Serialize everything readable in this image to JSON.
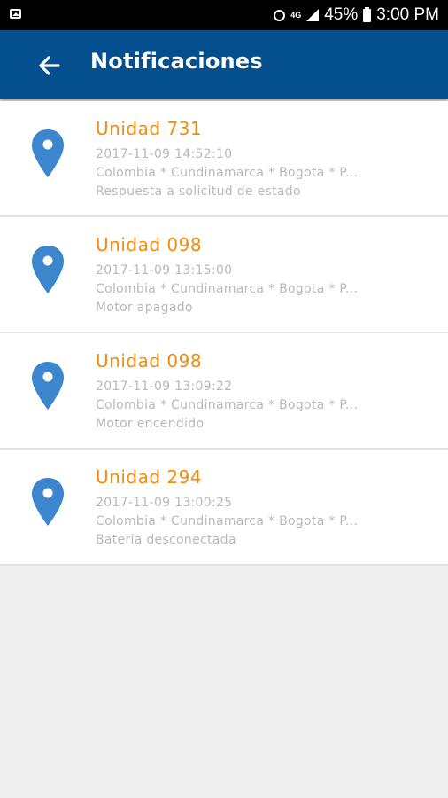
{
  "status_bar": {
    "network": "4G",
    "battery": "45%",
    "time": "3:00 PM",
    "icons": [
      "gallery-icon",
      "alarm-icon",
      "network-4g-icon",
      "signal-icon",
      "battery-icon"
    ]
  },
  "app_bar": {
    "title": "Notificaciones",
    "background": "#04508e",
    "back_icon": "arrow-back-icon"
  },
  "colors": {
    "unit_title": "#f38b0b",
    "pin": "#3b86cc",
    "secondary_text": "#b9b9b9"
  },
  "notifications": [
    {
      "unit": "Unidad 731",
      "datetime": "2017-11-09 14:52:10",
      "location": "Colombia * Cundinamarca * Bogota * P...",
      "message": "Respuesta a solicitud de estado",
      "icon": "location-pin-icon"
    },
    {
      "unit": "Unidad 098",
      "datetime": "2017-11-09 13:15:00",
      "location": "Colombia * Cundinamarca * Bogota * P...",
      "message": "Motor apagado",
      "icon": "location-pin-icon"
    },
    {
      "unit": "Unidad 098",
      "datetime": "2017-11-09 13:09:22",
      "location": "Colombia * Cundinamarca * Bogota * P...",
      "message": "Motor encendido",
      "icon": "location-pin-icon"
    },
    {
      "unit": "Unidad 294",
      "datetime": "2017-11-09 13:00:25",
      "location": "Colombia * Cundinamarca * Bogota * P...",
      "message": "Bateria desconectada",
      "icon": "location-pin-icon"
    }
  ]
}
